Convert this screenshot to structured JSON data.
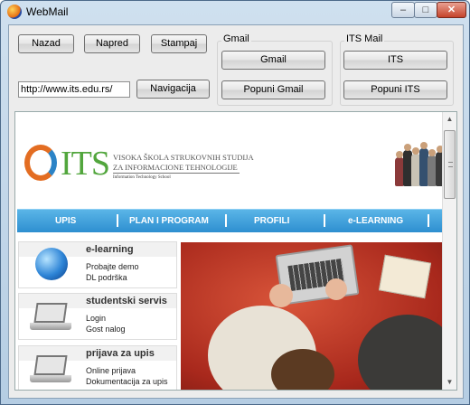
{
  "window": {
    "title": "WebMail",
    "min_glyph": "–",
    "max_glyph": "□",
    "close_glyph": "✕"
  },
  "toolbar": {
    "nazad": "Nazad",
    "napred": "Napred",
    "stampaj": "Stampaj",
    "url_value": "http://www.its.edu.rs/",
    "navigacija": "Navigacija"
  },
  "gmail": {
    "group_label": "Gmail",
    "open": "Gmail",
    "fill": "Popuni Gmail"
  },
  "itsmail": {
    "group_label": "ITS Mail",
    "open": "ITS",
    "fill": "Popuni ITS"
  },
  "page": {
    "logo": {
      "mark": "ITS",
      "line1": "VISOKA ŠKOLA STRUKOVNIH STUDIJA",
      "line2": "ZA INFORMACIONE TEHNOLOGIJE",
      "line3": "Information Technology School"
    },
    "nav": [
      "UPIS",
      "PLAN I PROGRAM",
      "PROFILI",
      "e-LEARNING"
    ],
    "cards": [
      {
        "title": "e-learning",
        "line1": "Probajte demo",
        "line2": "DL podrška"
      },
      {
        "title": "studentski servis",
        "line1": "Login",
        "line2": "Gost nalog"
      },
      {
        "title": "prijava za upis",
        "line1": "Online prijava",
        "line2": "Dokumentacija za upis"
      }
    ]
  },
  "colors": {
    "accent_blue": "#2e8fd0",
    "its_green": "#52a63d",
    "its_orange": "#e36d22"
  }
}
